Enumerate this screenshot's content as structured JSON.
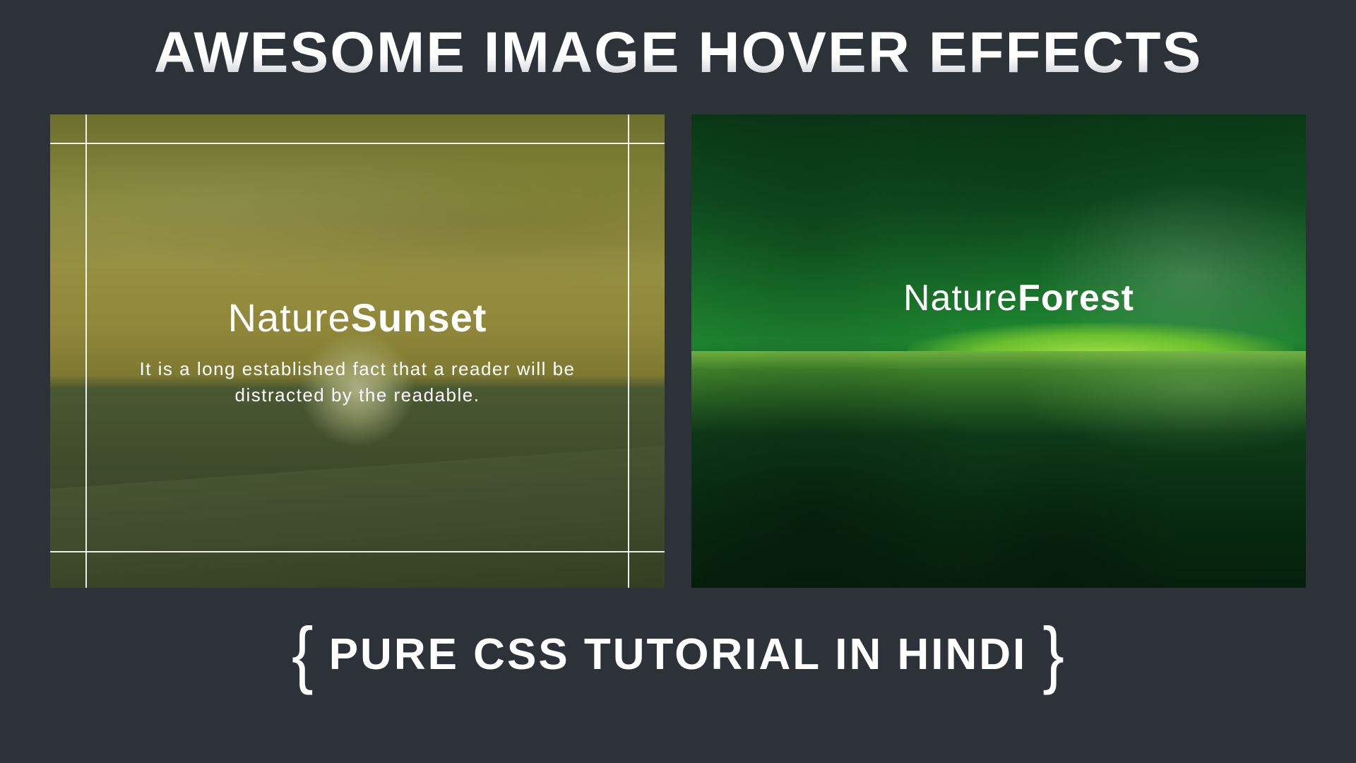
{
  "headline": "AWESOME IMAGE HOVER EFFECTS",
  "cards": {
    "sunset": {
      "title_light": "Nature",
      "title_bold": "Sunset",
      "description": "It is a long established fact that a reader will be distracted by the readable."
    },
    "forest": {
      "title_light": "Nature",
      "title_bold": "Forest"
    }
  },
  "footer": {
    "left_brace": "{",
    "text": "PURE CSS TUTORIAL IN HINDI",
    "right_brace": "}"
  }
}
